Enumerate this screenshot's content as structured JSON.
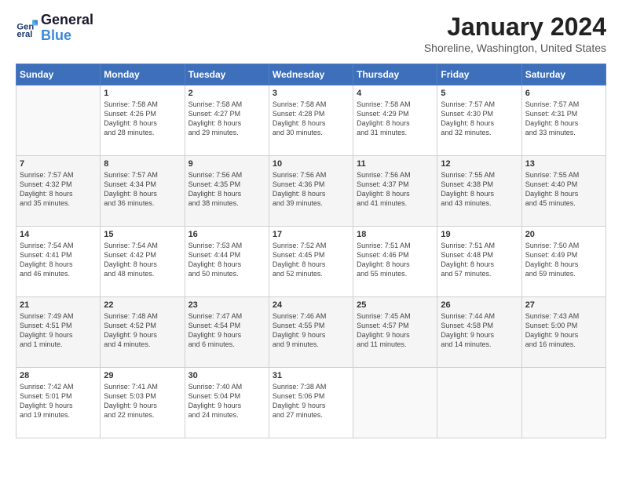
{
  "header": {
    "logo_line1": "General",
    "logo_line2": "Blue",
    "month": "January 2024",
    "location": "Shoreline, Washington, United States"
  },
  "days_of_week": [
    "Sunday",
    "Monday",
    "Tuesday",
    "Wednesday",
    "Thursday",
    "Friday",
    "Saturday"
  ],
  "weeks": [
    [
      {
        "day": "",
        "content": ""
      },
      {
        "day": "1",
        "content": "Sunrise: 7:58 AM\nSunset: 4:26 PM\nDaylight: 8 hours\nand 28 minutes."
      },
      {
        "day": "2",
        "content": "Sunrise: 7:58 AM\nSunset: 4:27 PM\nDaylight: 8 hours\nand 29 minutes."
      },
      {
        "day": "3",
        "content": "Sunrise: 7:58 AM\nSunset: 4:28 PM\nDaylight: 8 hours\nand 30 minutes."
      },
      {
        "day": "4",
        "content": "Sunrise: 7:58 AM\nSunset: 4:29 PM\nDaylight: 8 hours\nand 31 minutes."
      },
      {
        "day": "5",
        "content": "Sunrise: 7:57 AM\nSunset: 4:30 PM\nDaylight: 8 hours\nand 32 minutes."
      },
      {
        "day": "6",
        "content": "Sunrise: 7:57 AM\nSunset: 4:31 PM\nDaylight: 8 hours\nand 33 minutes."
      }
    ],
    [
      {
        "day": "7",
        "content": "Sunrise: 7:57 AM\nSunset: 4:32 PM\nDaylight: 8 hours\nand 35 minutes."
      },
      {
        "day": "8",
        "content": "Sunrise: 7:57 AM\nSunset: 4:34 PM\nDaylight: 8 hours\nand 36 minutes."
      },
      {
        "day": "9",
        "content": "Sunrise: 7:56 AM\nSunset: 4:35 PM\nDaylight: 8 hours\nand 38 minutes."
      },
      {
        "day": "10",
        "content": "Sunrise: 7:56 AM\nSunset: 4:36 PM\nDaylight: 8 hours\nand 39 minutes."
      },
      {
        "day": "11",
        "content": "Sunrise: 7:56 AM\nSunset: 4:37 PM\nDaylight: 8 hours\nand 41 minutes."
      },
      {
        "day": "12",
        "content": "Sunrise: 7:55 AM\nSunset: 4:38 PM\nDaylight: 8 hours\nand 43 minutes."
      },
      {
        "day": "13",
        "content": "Sunrise: 7:55 AM\nSunset: 4:40 PM\nDaylight: 8 hours\nand 45 minutes."
      }
    ],
    [
      {
        "day": "14",
        "content": "Sunrise: 7:54 AM\nSunset: 4:41 PM\nDaylight: 8 hours\nand 46 minutes."
      },
      {
        "day": "15",
        "content": "Sunrise: 7:54 AM\nSunset: 4:42 PM\nDaylight: 8 hours\nand 48 minutes."
      },
      {
        "day": "16",
        "content": "Sunrise: 7:53 AM\nSunset: 4:44 PM\nDaylight: 8 hours\nand 50 minutes."
      },
      {
        "day": "17",
        "content": "Sunrise: 7:52 AM\nSunset: 4:45 PM\nDaylight: 8 hours\nand 52 minutes."
      },
      {
        "day": "18",
        "content": "Sunrise: 7:51 AM\nSunset: 4:46 PM\nDaylight: 8 hours\nand 55 minutes."
      },
      {
        "day": "19",
        "content": "Sunrise: 7:51 AM\nSunset: 4:48 PM\nDaylight: 8 hours\nand 57 minutes."
      },
      {
        "day": "20",
        "content": "Sunrise: 7:50 AM\nSunset: 4:49 PM\nDaylight: 8 hours\nand 59 minutes."
      }
    ],
    [
      {
        "day": "21",
        "content": "Sunrise: 7:49 AM\nSunset: 4:51 PM\nDaylight: 9 hours\nand 1 minute."
      },
      {
        "day": "22",
        "content": "Sunrise: 7:48 AM\nSunset: 4:52 PM\nDaylight: 9 hours\nand 4 minutes."
      },
      {
        "day": "23",
        "content": "Sunrise: 7:47 AM\nSunset: 4:54 PM\nDaylight: 9 hours\nand 6 minutes."
      },
      {
        "day": "24",
        "content": "Sunrise: 7:46 AM\nSunset: 4:55 PM\nDaylight: 9 hours\nand 9 minutes."
      },
      {
        "day": "25",
        "content": "Sunrise: 7:45 AM\nSunset: 4:57 PM\nDaylight: 9 hours\nand 11 minutes."
      },
      {
        "day": "26",
        "content": "Sunrise: 7:44 AM\nSunset: 4:58 PM\nDaylight: 9 hours\nand 14 minutes."
      },
      {
        "day": "27",
        "content": "Sunrise: 7:43 AM\nSunset: 5:00 PM\nDaylight: 9 hours\nand 16 minutes."
      }
    ],
    [
      {
        "day": "28",
        "content": "Sunrise: 7:42 AM\nSunset: 5:01 PM\nDaylight: 9 hours\nand 19 minutes."
      },
      {
        "day": "29",
        "content": "Sunrise: 7:41 AM\nSunset: 5:03 PM\nDaylight: 9 hours\nand 22 minutes."
      },
      {
        "day": "30",
        "content": "Sunrise: 7:40 AM\nSunset: 5:04 PM\nDaylight: 9 hours\nand 24 minutes."
      },
      {
        "day": "31",
        "content": "Sunrise: 7:38 AM\nSunset: 5:06 PM\nDaylight: 9 hours\nand 27 minutes."
      },
      {
        "day": "",
        "content": ""
      },
      {
        "day": "",
        "content": ""
      },
      {
        "day": "",
        "content": ""
      }
    ]
  ]
}
